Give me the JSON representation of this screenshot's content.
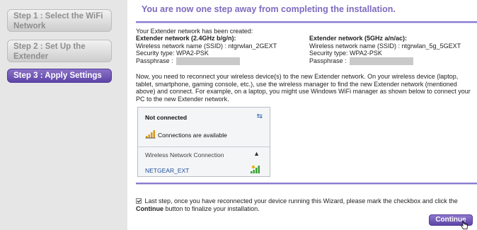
{
  "sidebar": {
    "steps": [
      {
        "label": "Step 1 : Select the WiFi Network",
        "state": "inactive"
      },
      {
        "label": "Step 2 : Set Up the Extender",
        "state": "inactive"
      },
      {
        "label": "Step 3 : Apply Settings",
        "state": "active"
      }
    ]
  },
  "main": {
    "headline": "You are now one step away from completing the installation.",
    "created_text": "Your Extender network has been created:",
    "network24": {
      "header": "Extender network (2.4GHz b/g/n):",
      "ssid_line": "Wireless network name (SSID) :  ntgrwlan_2GEXT",
      "security_line": "Security type: WPA2-PSK",
      "pass_label": "Passphrase :"
    },
    "network5": {
      "header": "Extender network (5GHz a/n/ac):",
      "ssid_line": "Wireless network name (SSID) :  ntgrwlan_5g_5GEXT",
      "security_line": "Security type: WPA2-PSK",
      "pass_label": "Passphrase :"
    },
    "instructions": "Now, you need to reconnect your wireless device(s) to the new Extender network. On your wireless device (laptop, tablet, smartphone, gaming console, etc.), use the wireless manager to find the new Extender network (mentioned above) and connect. For example, on a laptop, you might use Windows WiFi manager as shown below to connect your PC to the new Extender network.",
    "wifi_popup": {
      "status": "Not connected",
      "available": "Connections are available",
      "section": "Wireless Network Connection",
      "network": "NETGEAR_EXT"
    },
    "footer": {
      "text_before": "Last step, once you have reconnected your device running this Wizard, please mark the checkbox and click the ",
      "bold_word": "Continue",
      "text_after": " button to finalize your installation."
    },
    "continue_label": "Continue"
  },
  "colors": {
    "accent": "#7e6ac0",
    "button": "#5e45a8",
    "sidebar_bg": "#e6e6e6"
  }
}
